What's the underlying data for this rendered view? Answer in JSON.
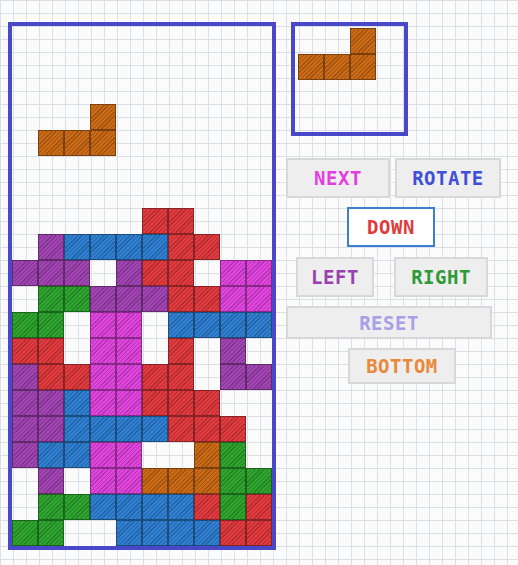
{
  "board": {
    "rows": [
      [
        "",
        "",
        "",
        "",
        "",
        "",
        "",
        "",
        "",
        ""
      ],
      [
        "",
        "",
        "",
        "",
        "",
        "",
        "",
        "",
        "",
        ""
      ],
      [
        "",
        "",
        "",
        "",
        "",
        "",
        "",
        "",
        "",
        ""
      ],
      [
        "",
        "",
        "",
        "O",
        "",
        "",
        "",
        "",
        "",
        ""
      ],
      [
        "",
        "O",
        "O",
        "O",
        "",
        "",
        "",
        "",
        "",
        ""
      ],
      [
        "",
        "",
        "",
        "",
        "",
        "",
        "",
        "",
        "",
        ""
      ],
      [
        "",
        "",
        "",
        "",
        "",
        "",
        "",
        "",
        "",
        ""
      ],
      [
        "",
        "",
        "",
        "",
        "",
        "R",
        "R",
        "",
        "",
        ""
      ],
      [
        "",
        "P",
        "B",
        "B",
        "B",
        "B",
        "R",
        "R",
        "",
        ""
      ],
      [
        "P",
        "P",
        "P",
        "",
        "P",
        "R",
        "R",
        "",
        "M",
        "M"
      ],
      [
        "",
        "G",
        "G",
        "P",
        "P",
        "P",
        "R",
        "R",
        "M",
        "M"
      ],
      [
        "G",
        "G",
        "",
        "M",
        "M",
        "",
        "B",
        "B",
        "B",
        "B"
      ],
      [
        "R",
        "R",
        "",
        "M",
        "M",
        "",
        "R",
        "",
        "P",
        ""
      ],
      [
        "P",
        "R",
        "R",
        "M",
        "M",
        "R",
        "R",
        "",
        "P",
        "P"
      ],
      [
        "P",
        "P",
        "B",
        "M",
        "M",
        "R",
        "R",
        "R",
        "",
        ""
      ],
      [
        "P",
        "P",
        "B",
        "B",
        "B",
        "B",
        "R",
        "R",
        "R",
        ""
      ],
      [
        "P",
        "B",
        "B",
        "M",
        "M",
        "",
        "",
        "O",
        "G",
        ""
      ],
      [
        "",
        "P",
        "",
        "M",
        "M",
        "O",
        "O",
        "O",
        "G",
        "G"
      ],
      [
        "",
        "G",
        "G",
        "B",
        "B",
        "B",
        "B",
        "R",
        "G",
        "R"
      ],
      [
        "G",
        "G",
        "",
        "",
        "B",
        "B",
        "B",
        "B",
        "R",
        "R"
      ]
    ]
  },
  "palette": {
    "P": "#a244b4",
    "B": "#2f80d2",
    "R": "#e23a3e",
    "M": "#e244e0",
    "G": "#2ea52e",
    "O": "#cc6a16"
  },
  "next": {
    "rows": [
      [
        "",
        "",
        "O"
      ],
      [
        "O",
        "O",
        "O"
      ]
    ]
  },
  "buttons": [
    {
      "label": "NEXT",
      "color": "#e040e0",
      "focused": false
    },
    {
      "label": "ROTATE",
      "color": "#3f4fd8",
      "focused": false
    },
    {
      "label": "DOWN",
      "color": "#e03a3a",
      "focused": true
    },
    {
      "label": "LEFT",
      "color": "#9a40b0",
      "focused": false
    },
    {
      "label": "RIGHT",
      "color": "#2e9a3a",
      "focused": false
    },
    {
      "label": "RESET",
      "color": "#a7a0e8",
      "focused": false
    },
    {
      "label": "BOTTOM",
      "color": "#e8893a",
      "focused": false
    }
  ]
}
